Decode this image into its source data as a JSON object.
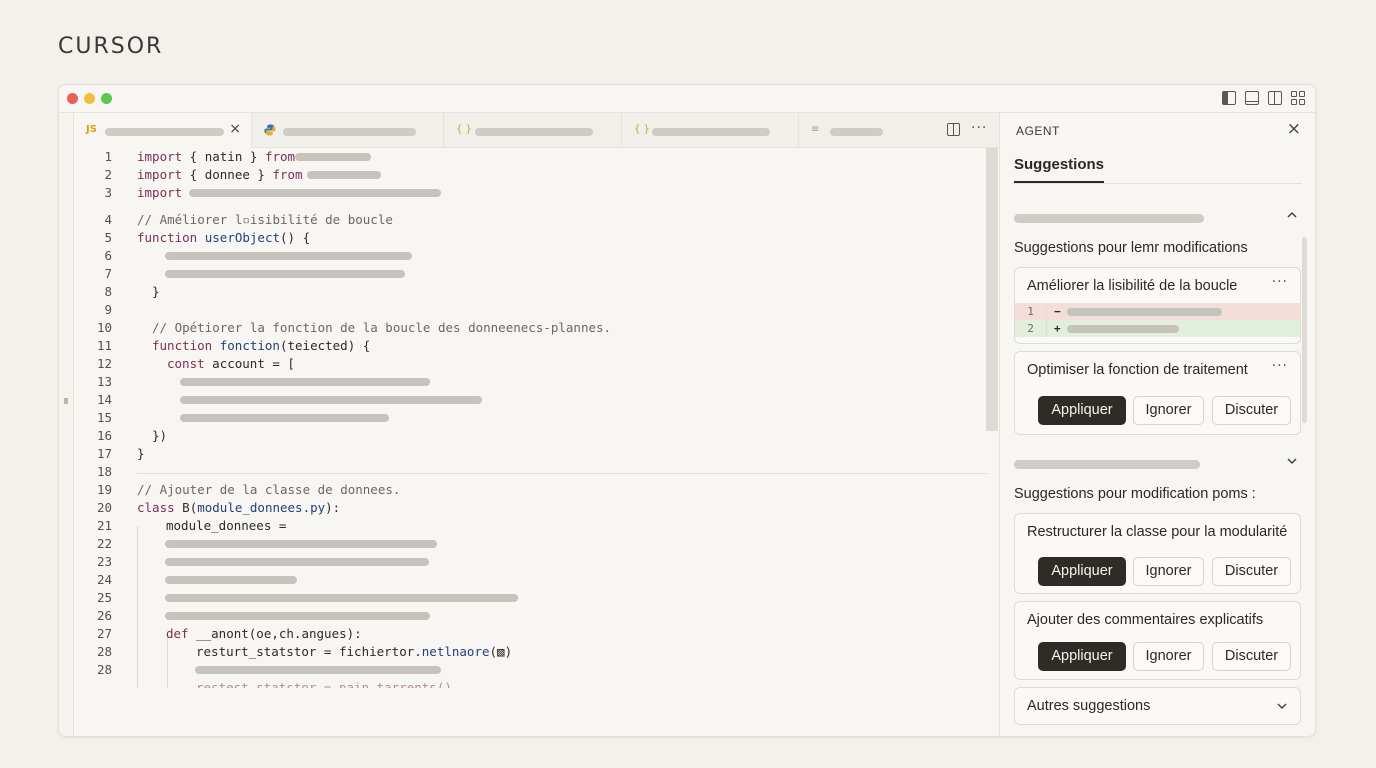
{
  "brand": "CURSOR",
  "tabs": [
    {
      "icon": "JS",
      "icon_color": "#d8a019",
      "closable": true
    },
    {
      "icon": "python-icon",
      "icon_color": "#3f6fa8",
      "closable": false
    },
    {
      "icon": "{ }",
      "icon_color": "#c9a33a",
      "closable": false
    },
    {
      "icon": "{ }",
      "icon_color": "#c9a33a",
      "closable": false
    },
    {
      "icon": "≡",
      "icon_color": "#9a978f",
      "closable": false
    }
  ],
  "tab_close": "×",
  "more": "···",
  "code": {
    "lines": [
      {
        "n": "1"
      },
      {
        "n": "2"
      },
      {
        "n": "3"
      },
      {
        "n": "4"
      },
      {
        "n": "5"
      },
      {
        "n": "6"
      },
      {
        "n": "7"
      },
      {
        "n": "8"
      },
      {
        "n": "9"
      },
      {
        "n": "10"
      },
      {
        "n": "11"
      },
      {
        "n": "12"
      },
      {
        "n": "13"
      },
      {
        "n": "14"
      },
      {
        "n": "15"
      },
      {
        "n": "16"
      },
      {
        "n": "17"
      },
      {
        "n": "18"
      },
      {
        "n": "19"
      },
      {
        "n": "20"
      },
      {
        "n": "21"
      },
      {
        "n": "22"
      },
      {
        "n": "23"
      },
      {
        "n": "24"
      },
      {
        "n": "25"
      },
      {
        "n": "26"
      },
      {
        "n": "27"
      },
      {
        "n": "28"
      }
    ],
    "l1_kw": "import",
    "l1_mid": " { natin } ",
    "l1_from": "from",
    "l2_kw": "import",
    "l2_mid": " { donnee } ",
    "l2_from": "from",
    "l3_kw": "import",
    "l4": "// Améliorer l▫isibilité de boucle",
    "l5_kw": "function",
    "l5_fn": "userObject",
    "l5_rest": "() {",
    "l8": "}",
    "l10": "// Opétiorer la fonction de la boucle des donneenecs-plannes.",
    "l11_kw": "function",
    "l11_fn": "fonction",
    "l11_rest": "(teiected) {",
    "l12_kw": "const",
    "l12_rest": " account = [",
    "l16": "})",
    "l17": "}",
    "l19": "// Ajouter de la classe de donnees.",
    "l20_kw": "class",
    "l20_rest": " B(",
    "l20_fn": "module_donnees.py",
    "l20_end": "):",
    "l21": "module_donnees =",
    "l26_kw": "def",
    "l26_rest": " __anont(oe,ch.angues):",
    "l27_a": "resturt_statstor = fichiertor.",
    "l27_fn": "netlnaore",
    "l27_end": "(▧)",
    "l29": "restest_statstor = pain_tarrents()"
  },
  "agent": {
    "header": "AGENT",
    "close": "×",
    "tab": "Suggestions",
    "section1": {
      "title": "Suggestions pour lemr modifications",
      "chevron": "^",
      "cards": [
        {
          "title": "Améliorer la lisibilité de la boucle",
          "diff": [
            {
              "n": "1",
              "sign": "−"
            },
            {
              "n": "2",
              "sign": "+"
            }
          ]
        },
        {
          "title": "Optimiser la fonction de traitement"
        }
      ]
    },
    "section2": {
      "title": "Suggestions pour modification poms :",
      "chevron": "v",
      "cards": [
        {
          "title": "Restructurer la classe pour la modularité"
        },
        {
          "title": "Ajouter des commentaires explicatifs"
        }
      ]
    },
    "buttons": {
      "apply": "Appliquer",
      "ignore": "Ignorer",
      "discuss": "Discuter"
    },
    "more_suggestions": "Autres suggestions"
  }
}
